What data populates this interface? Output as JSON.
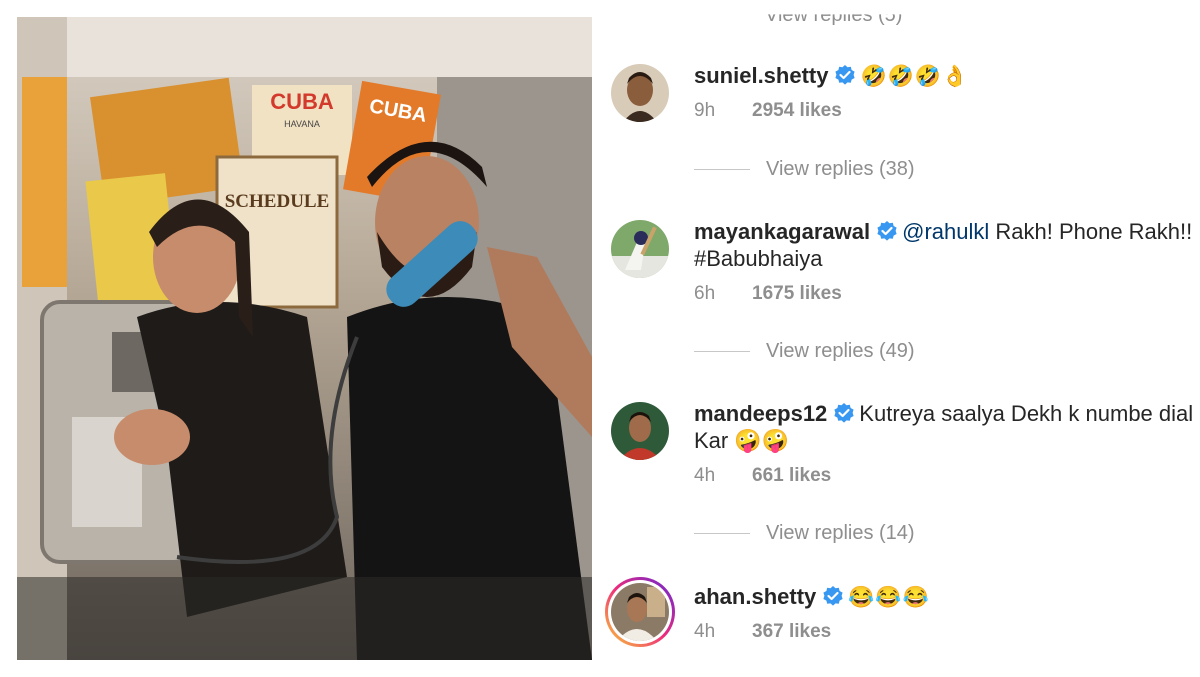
{
  "post_image": {
    "alt_signs": [
      "CUBA",
      "HAVANA",
      "SCHEDULE",
      "CUBA"
    ]
  },
  "comments": {
    "top_view_replies": "View replies (5)",
    "items": [
      {
        "username": "suniel.shetty",
        "verified": true,
        "mention": "",
        "text": "🤣🤣🤣👌",
        "time": "9h",
        "likes": "2954 likes",
        "view_replies": "View replies (38)",
        "avatar_color": "#7a5a3c"
      },
      {
        "username": "mayankagarawal",
        "verified": true,
        "mention": "@rahulkl",
        "text": " Rakh! Phone Rakh!! #Babubhaiya",
        "time": "6h",
        "likes": "1675 likes",
        "view_replies": "View replies (49)",
        "avatar_color": "#3f6d3a"
      },
      {
        "username": "mandeeps12",
        "verified": true,
        "mention": "",
        "text": "Kutreya saalya Dekh k numbe dial Kar 🤪🤪",
        "time": "4h",
        "likes": "661 likes",
        "view_replies": "View replies (14)",
        "avatar_color": "#b33a2b"
      },
      {
        "username": "ahan.shetty",
        "verified": true,
        "mention": "",
        "text": "😂😂😂",
        "time": "4h",
        "likes": "367 likes",
        "view_replies": "",
        "avatar_color": "#5a4a3e"
      }
    ]
  },
  "colors": {
    "verified_blue": "#3897f0",
    "meta_gray": "#8e8e8e",
    "mention_blue": "#00376b"
  }
}
